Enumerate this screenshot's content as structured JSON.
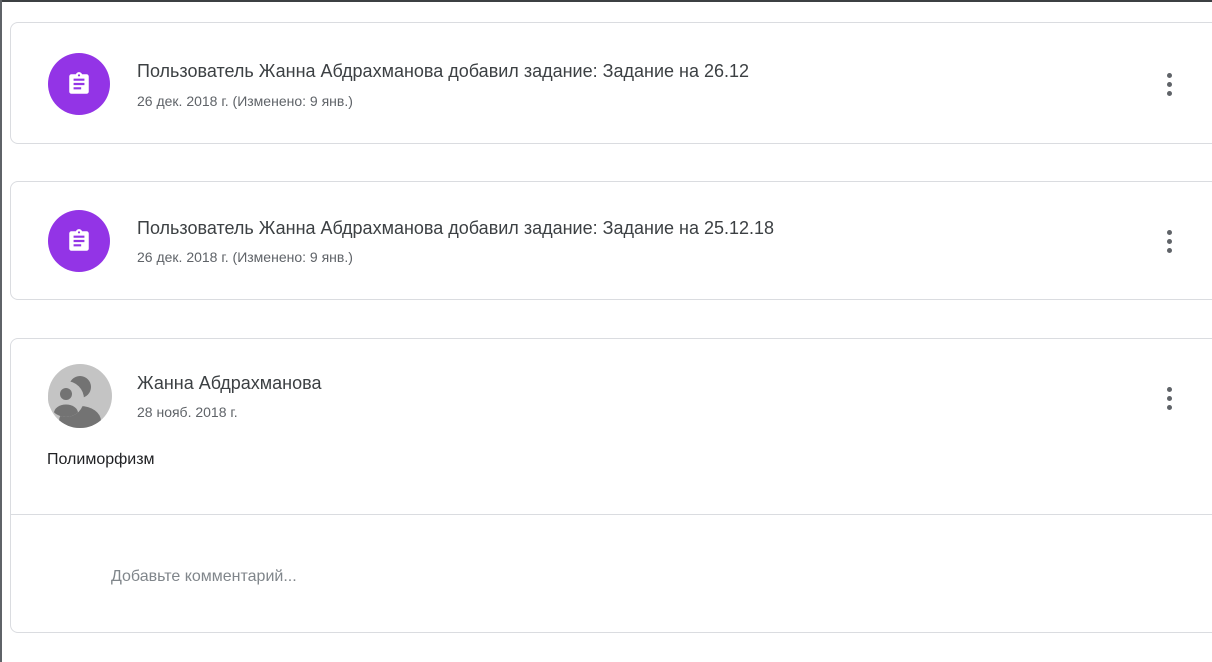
{
  "stream": {
    "items": [
      {
        "title": "Пользователь Жанна Абдрахманова добавил задание: Задание на 26.12",
        "date": "26 дек. 2018 г. (Изменено: 9 янв.)",
        "icon": "assignment-icon"
      },
      {
        "title": "Пользователь Жанна Абдрахманова добавил задание: Задание на 25.12.18",
        "date": "26 дек. 2018 г. (Изменено: 9 янв.)",
        "icon": "assignment-icon"
      }
    ],
    "post": {
      "author": "Жанна Абдрахманова",
      "date": "28 нояб. 2018 г.",
      "text": "Полиморфизм",
      "comment_placeholder": "Добавьте комментарий..."
    }
  },
  "colors": {
    "accent": "#9334e6",
    "avatar_bg": "#c4c4c4"
  }
}
